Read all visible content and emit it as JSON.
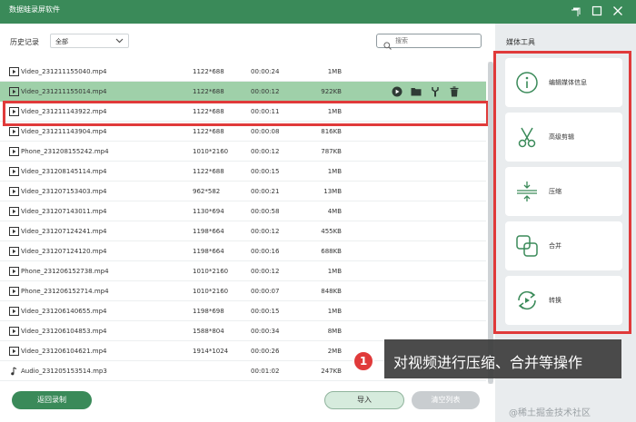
{
  "app": {
    "title": "数据蛙录屏软件"
  },
  "toolbar": {
    "history_label": "历史记录",
    "filter_value": "全部",
    "search_placeholder": "搜索"
  },
  "files": [
    {
      "type": "video",
      "name": "Video_231211155040.mp4",
      "resolution": "1122*688",
      "duration": "00:00:24",
      "size": "1MB"
    },
    {
      "type": "video",
      "name": "Video_231211155014.mp4",
      "resolution": "1122*688",
      "duration": "00:00:12",
      "size": "922KB"
    },
    {
      "type": "video",
      "name": "Video_231211143922.mp4",
      "resolution": "1122*688",
      "duration": "00:00:11",
      "size": "1MB"
    },
    {
      "type": "video",
      "name": "Video_231211143904.mp4",
      "resolution": "1122*688",
      "duration": "00:00:08",
      "size": "816KB"
    },
    {
      "type": "video",
      "name": "Phone_231208155242.mp4",
      "resolution": "1010*2160",
      "duration": "00:00:12",
      "size": "787KB"
    },
    {
      "type": "video",
      "name": "Video_231208145114.mp4",
      "resolution": "1122*688",
      "duration": "00:00:15",
      "size": "1MB"
    },
    {
      "type": "video",
      "name": "Video_231207153403.mp4",
      "resolution": "962*582",
      "duration": "00:00:21",
      "size": "13MB"
    },
    {
      "type": "video",
      "name": "Video_231207143011.mp4",
      "resolution": "1130*694",
      "duration": "00:00:58",
      "size": "4MB"
    },
    {
      "type": "video",
      "name": "Video_231207124241.mp4",
      "resolution": "1198*664",
      "duration": "00:00:12",
      "size": "455KB"
    },
    {
      "type": "video",
      "name": "Video_231207124120.mp4",
      "resolution": "1198*664",
      "duration": "00:00:16",
      "size": "688KB"
    },
    {
      "type": "video",
      "name": "Phone_231206152738.mp4",
      "resolution": "1010*2160",
      "duration": "00:00:12",
      "size": "1MB"
    },
    {
      "type": "video",
      "name": "Phone_231206152714.mp4",
      "resolution": "1010*2160",
      "duration": "00:00:07",
      "size": "848KB"
    },
    {
      "type": "video",
      "name": "Video_231206140655.mp4",
      "resolution": "1198*698",
      "duration": "00:00:15",
      "size": "1MB"
    },
    {
      "type": "video",
      "name": "Video_231206104853.mp4",
      "resolution": "1588*804",
      "duration": "00:00:34",
      "size": "8MB"
    },
    {
      "type": "video",
      "name": "Video_231206104621.mp4",
      "resolution": "1914*1024",
      "duration": "00:00:26",
      "size": "2MB"
    },
    {
      "type": "audio",
      "name": "Audio_231205153514.mp3",
      "resolution": "",
      "duration": "00:01:02",
      "size": "247KB"
    }
  ],
  "selected_index": 1,
  "panel": {
    "title": "媒体工具",
    "tools": [
      {
        "label": "编辑媒体信息",
        "icon": "info-icon"
      },
      {
        "label": "高级剪辑",
        "icon": "scissors-icon"
      },
      {
        "label": "压缩",
        "icon": "compress-icon"
      },
      {
        "label": "合并",
        "icon": "merge-icon"
      },
      {
        "label": "转换",
        "icon": "convert-icon"
      }
    ]
  },
  "buttons": {
    "back": "返回录制",
    "import": "导入",
    "clear": "清空列表"
  },
  "callout": {
    "number": "1",
    "text": "对视频进行压缩、合并等操作"
  },
  "watermark": "@稀土掘金技术社区",
  "colors": {
    "accent": "#3a8a59",
    "selected_row": "#9fd0a9",
    "highlight": "#e03a3a"
  }
}
